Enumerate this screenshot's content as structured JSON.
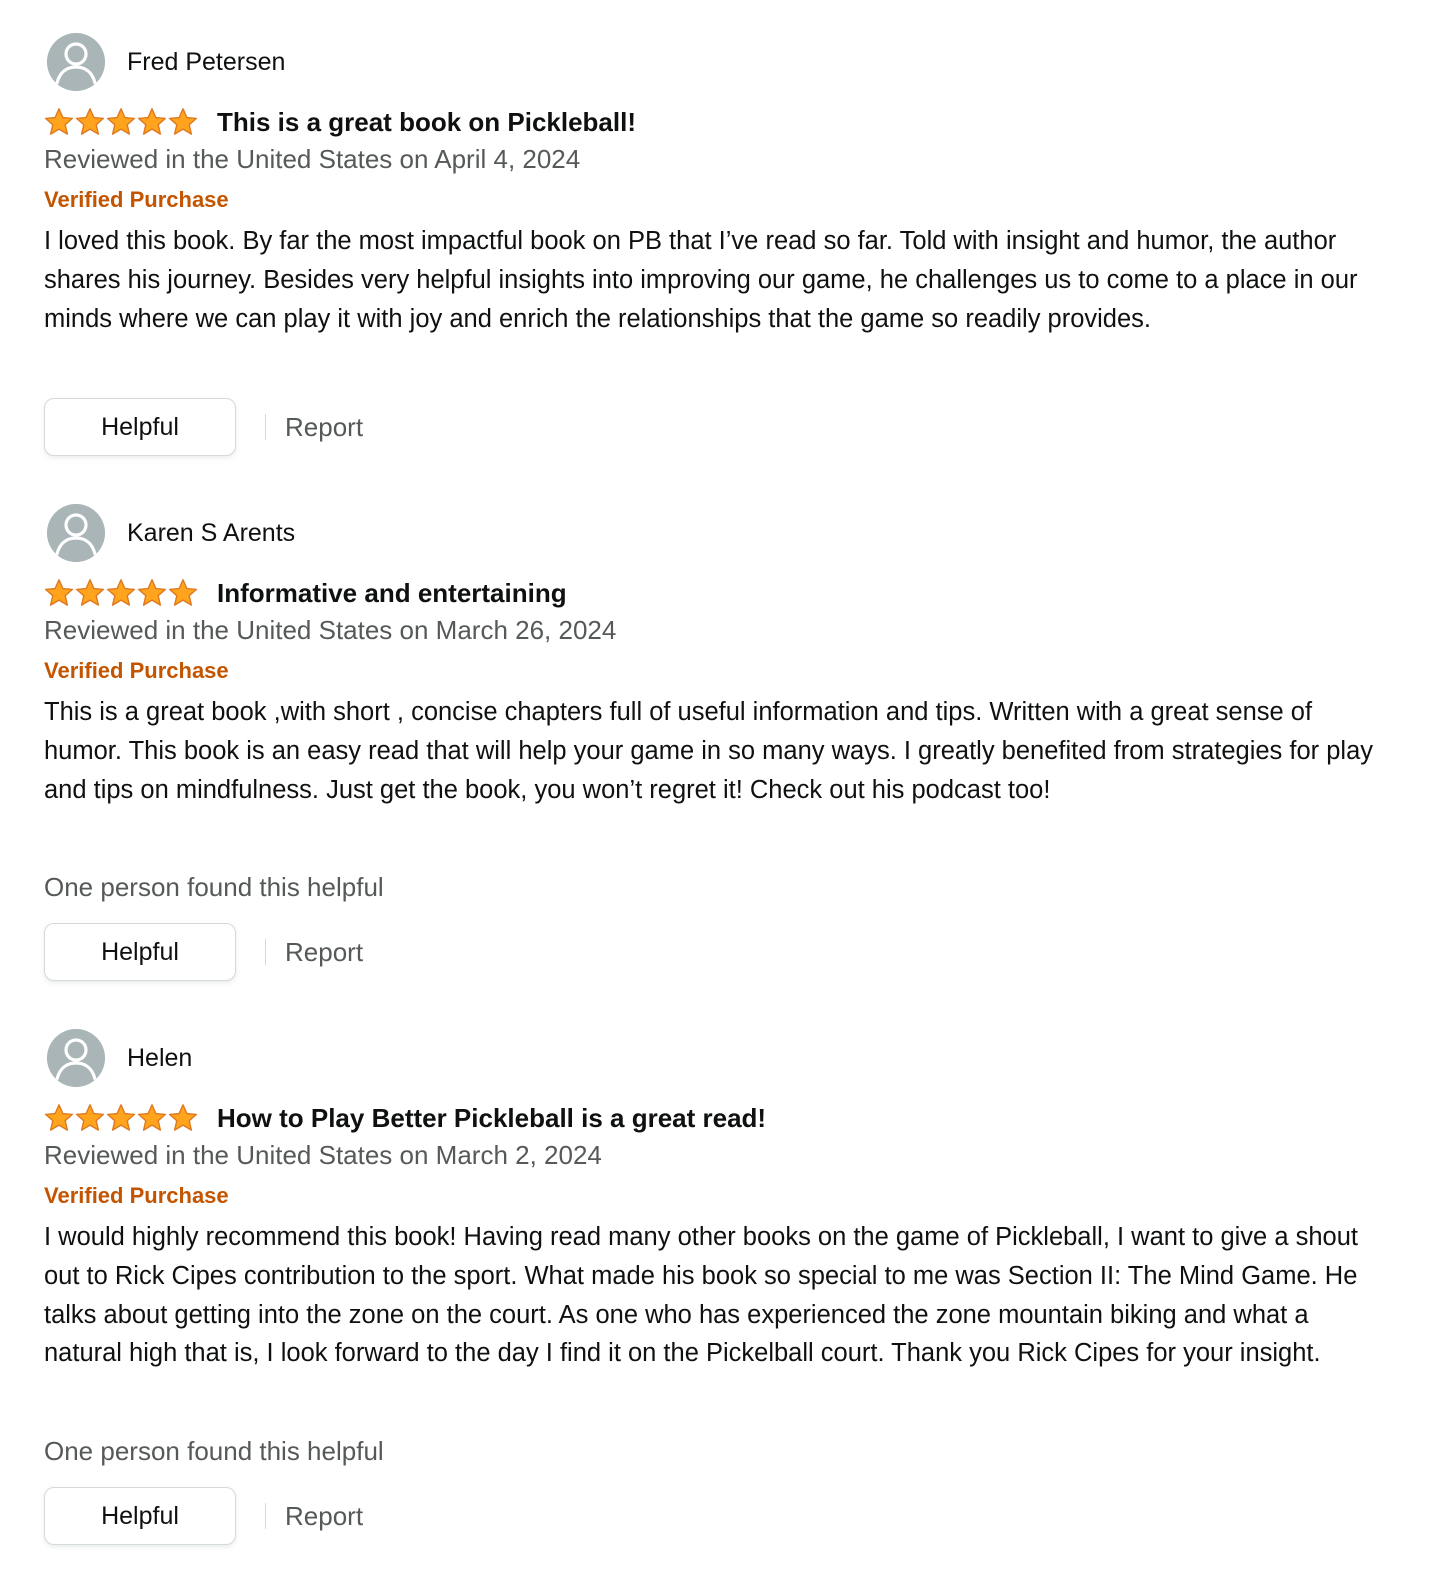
{
  "colors": {
    "star": "#ffa41c",
    "star_stroke": "#de7921",
    "verified": "#c45500",
    "secondary_text": "#565959",
    "avatar_bg": "#a9b5b7"
  },
  "icons": {
    "avatar": "user-silhouette-icon",
    "star": "star-icon"
  },
  "reviews": [
    {
      "reviewer": "Fred Petersen",
      "rating": 5,
      "title": "This is a great book on Pickleball!",
      "date": "Reviewed in the United States on April 4, 2024",
      "verified": "Verified Purchase",
      "body": "I loved this book. By far the most impactful book on PB that I’ve read so far. Told with insight and humor, the author shares his journey. Besides very helpful insights into improving our game, he challenges us to come to a place in our minds where we can play it with joy and enrich the relationships that the game so readily provides.",
      "helpful_count": "",
      "helpful_label": "Helpful",
      "report_label": "Report"
    },
    {
      "reviewer": "Karen S Arents",
      "rating": 5,
      "title": "Informative and entertaining",
      "date": "Reviewed in the United States on March 26, 2024",
      "verified": "Verified Purchase",
      "body": "This is a great book ,with short , concise chapters full of useful information and tips. Written with a great sense of humor. This book is an easy read that will help your game in so many ways. I greatly benefited from strategies for play and tips on mindfulness. Just get the book, you won’t regret it! Check out his podcast too!",
      "helpful_count": "One person found this helpful",
      "helpful_label": "Helpful",
      "report_label": "Report"
    },
    {
      "reviewer": "Helen",
      "rating": 5,
      "title": "How to Play Better Pickleball is a great read!",
      "date": "Reviewed in the United States on March 2, 2024",
      "verified": "Verified Purchase",
      "body": "I would highly recommend this book! Having read many other books on the game of Pickleball, I want to give a shout out to Rick Cipes contribution to the sport. What made his book so special to me was Section II: The Mind Game. He talks about getting into the zone on the court. As one who has experienced the zone mountain biking and what a natural high that is, I look forward to the day I find it on the Pickelball court. Thank you Rick Cipes for your insight.",
      "helpful_count": "One person found this helpful",
      "helpful_label": "Helpful",
      "report_label": "Report"
    }
  ]
}
